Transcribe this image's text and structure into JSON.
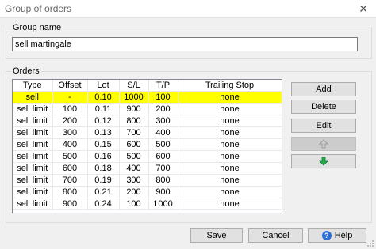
{
  "window": {
    "title": "Group of orders",
    "close_glyph": "✕"
  },
  "group_name": {
    "label": "Group name",
    "value": "sell martingale"
  },
  "orders": {
    "label": "Orders",
    "columns": [
      "Type",
      "Offset",
      "Lot",
      "S/L",
      "T/P",
      "Trailing Stop"
    ],
    "selected_row": 0,
    "selected_color": "#ffff00",
    "rows": [
      [
        "sell",
        "-",
        "0.10",
        "1000",
        "100",
        "none"
      ],
      [
        "sell limit",
        "100",
        "0.11",
        "900",
        "200",
        "none"
      ],
      [
        "sell limit",
        "200",
        "0.12",
        "800",
        "300",
        "none"
      ],
      [
        "sell limit",
        "300",
        "0.13",
        "700",
        "400",
        "none"
      ],
      [
        "sell limit",
        "400",
        "0.15",
        "600",
        "500",
        "none"
      ],
      [
        "sell limit",
        "500",
        "0.16",
        "500",
        "600",
        "none"
      ],
      [
        "sell limit",
        "600",
        "0.18",
        "400",
        "700",
        "none"
      ],
      [
        "sell limit",
        "700",
        "0.19",
        "300",
        "800",
        "none"
      ],
      [
        "sell limit",
        "800",
        "0.21",
        "200",
        "900",
        "none"
      ],
      [
        "sell limit",
        "900",
        "0.24",
        "100",
        "1000",
        "none"
      ]
    ]
  },
  "side_buttons": {
    "add": "Add",
    "delete": "Delete",
    "edit": "Edit",
    "move_up_icon": "arrow-up-icon",
    "move_down_icon": "arrow-down-icon",
    "arrow_up_color": "#c8c8c8",
    "arrow_down_color": "#22b14c"
  },
  "footer": {
    "save": "Save",
    "cancel": "Cancel",
    "help": "Help",
    "help_icon": "help-icon"
  }
}
